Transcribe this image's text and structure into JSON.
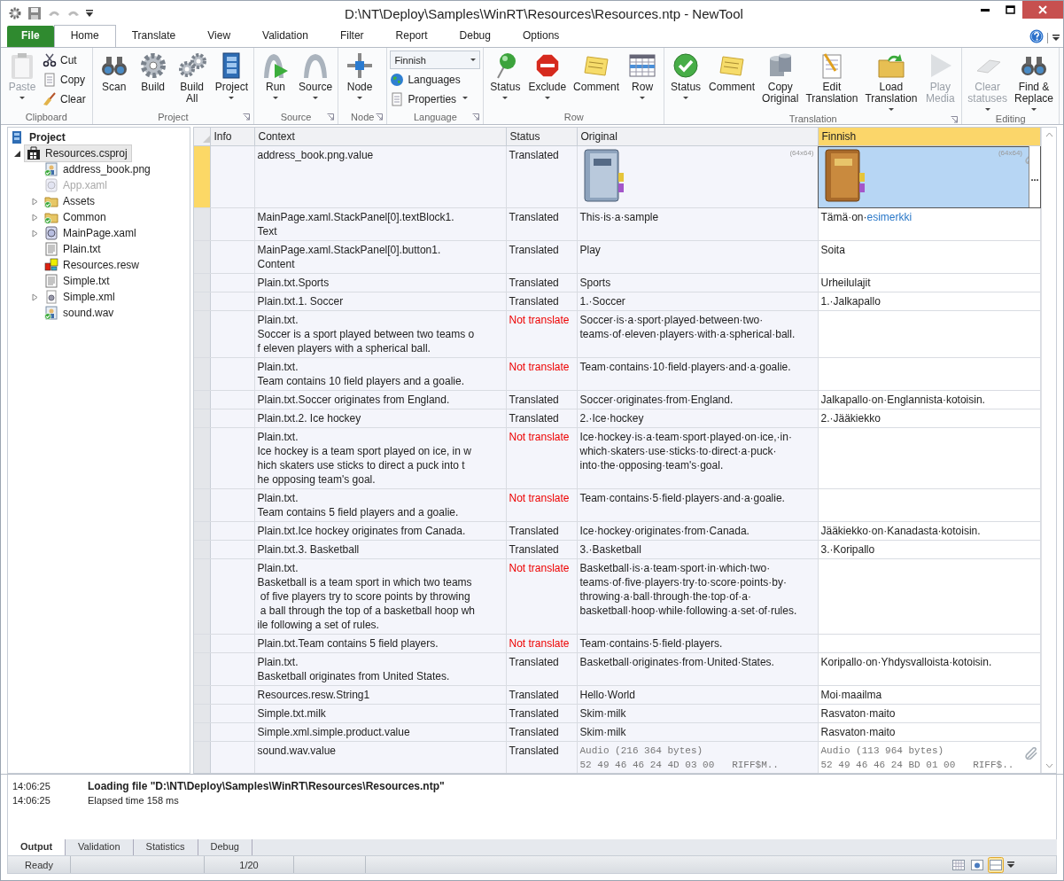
{
  "window": {
    "title": "D:\\NT\\Deploy\\Samples\\WinRT\\Resources\\Resources.ntp - NewTool"
  },
  "ribbon_tabs": [
    {
      "label": "File",
      "kind": "file",
      "selected": false
    },
    {
      "label": "Home",
      "kind": "tab",
      "selected": true
    },
    {
      "label": "Translate",
      "kind": "tab",
      "selected": false
    },
    {
      "label": "View",
      "kind": "tab",
      "selected": false
    },
    {
      "label": "Validation",
      "kind": "tab",
      "selected": false
    },
    {
      "label": "Filter",
      "kind": "tab",
      "selected": false
    },
    {
      "label": "Report",
      "kind": "tab",
      "selected": false
    },
    {
      "label": "Debug",
      "kind": "tab",
      "selected": false
    },
    {
      "label": "Options",
      "kind": "tab",
      "selected": false
    }
  ],
  "ribbon_groups": [
    {
      "title": "Clipboard",
      "launcher": false,
      "buttons": [
        {
          "kind": "large",
          "label": [
            "Paste"
          ],
          "has_menu": true,
          "disabled": true
        },
        {
          "kind": "small",
          "label": [
            "Cut"
          ],
          "has_menu": false,
          "disabled": false
        },
        {
          "kind": "small",
          "label": [
            "Copy"
          ],
          "has_menu": false,
          "disabled": false
        },
        {
          "kind": "small",
          "label": [
            "Clear"
          ],
          "has_menu": false,
          "disabled": false
        }
      ]
    },
    {
      "title": "Project",
      "launcher": true,
      "buttons": [
        {
          "kind": "large",
          "label": [
            "Scan"
          ],
          "has_menu": false,
          "disabled": false
        },
        {
          "kind": "large",
          "label": [
            "Build"
          ],
          "has_menu": false,
          "disabled": false
        },
        {
          "kind": "large",
          "label": [
            "Build",
            "All"
          ],
          "has_menu": false,
          "disabled": false
        },
        {
          "kind": "large",
          "label": [
            "Project"
          ],
          "has_menu": true,
          "disabled": false
        }
      ]
    },
    {
      "title": "Source",
      "launcher": true,
      "buttons": [
        {
          "kind": "large",
          "label": [
            "Run"
          ],
          "has_menu": true,
          "disabled": false
        },
        {
          "kind": "large",
          "label": [
            "Source"
          ],
          "has_menu": true,
          "disabled": false
        }
      ]
    },
    {
      "title": "Node",
      "launcher": true,
      "buttons": [
        {
          "kind": "large",
          "label": [
            "Node"
          ],
          "has_menu": true,
          "disabled": false
        }
      ]
    },
    {
      "title": "Language",
      "launcher": true,
      "buttons": [
        {
          "kind": "combo",
          "label": [
            "Finnish"
          ],
          "has_menu": true,
          "disabled": false
        },
        {
          "kind": "small",
          "label": [
            "Languages"
          ],
          "has_menu": false,
          "disabled": false
        },
        {
          "kind": "small",
          "label": [
            "Properties"
          ],
          "has_menu": true,
          "disabled": false
        }
      ]
    },
    {
      "title": "Row",
      "launcher": false,
      "buttons": [
        {
          "kind": "large",
          "label": [
            "Status"
          ],
          "has_menu": true,
          "disabled": false
        },
        {
          "kind": "large",
          "label": [
            "Exclude"
          ],
          "has_menu": true,
          "disabled": false
        },
        {
          "kind": "large",
          "label": [
            "Comment"
          ],
          "has_menu": false,
          "disabled": false
        },
        {
          "kind": "large",
          "label": [
            "Row"
          ],
          "has_menu": true,
          "disabled": false
        }
      ]
    },
    {
      "title": "Translation",
      "launcher": true,
      "buttons": [
        {
          "kind": "large",
          "label": [
            "Status"
          ],
          "has_menu": true,
          "disabled": false
        },
        {
          "kind": "large",
          "label": [
            "Comment"
          ],
          "has_menu": false,
          "disabled": false
        },
        {
          "kind": "large",
          "label": [
            "Copy",
            "Original"
          ],
          "has_menu": false,
          "disabled": false
        },
        {
          "kind": "large",
          "label": [
            "Edit",
            "Translation"
          ],
          "has_menu": false,
          "disabled": false
        },
        {
          "kind": "large",
          "label": [
            "Load",
            "Translation"
          ],
          "has_menu": true,
          "disabled": false
        },
        {
          "kind": "large",
          "label": [
            "Play",
            "Media"
          ],
          "has_menu": false,
          "disabled": true
        }
      ]
    },
    {
      "title": "Editing",
      "launcher": false,
      "buttons": [
        {
          "kind": "large",
          "label": [
            "Clear",
            "statuses"
          ],
          "has_menu": true,
          "disabled": true
        },
        {
          "kind": "large",
          "label": [
            "Find &",
            "Replace"
          ],
          "has_menu": true,
          "disabled": false
        }
      ]
    }
  ],
  "tree": {
    "label": "Project",
    "children": [
      {
        "label": "Resources.csproj",
        "kind": "project",
        "selected": true,
        "expanded": true,
        "translated": false,
        "disabled": false,
        "children": [
          {
            "label": "address_book.png",
            "kind": "image",
            "selected": false,
            "translated": true,
            "disabled": false
          },
          {
            "label": "App.xaml",
            "kind": "xaml",
            "selected": false,
            "translated": false,
            "disabled": true
          },
          {
            "label": "Assets",
            "kind": "folder",
            "selected": false,
            "expanded": false,
            "translated": true,
            "disabled": false
          },
          {
            "label": "Common",
            "kind": "folder",
            "selected": false,
            "expanded": false,
            "translated": true,
            "disabled": false
          },
          {
            "label": "MainPage.xaml",
            "kind": "xaml",
            "selected": false,
            "expanded": false,
            "translated": false,
            "disabled": false
          },
          {
            "label": "Plain.txt",
            "kind": "text",
            "selected": false,
            "translated": false,
            "disabled": false
          },
          {
            "label": "Resources.resw",
            "kind": "resw",
            "selected": false,
            "translated": false,
            "disabled": false
          },
          {
            "label": "Simple.txt",
            "kind": "text",
            "selected": false,
            "translated": false,
            "disabled": false
          },
          {
            "label": "Simple.xml",
            "kind": "xml",
            "selected": false,
            "expanded": false,
            "translated": false,
            "disabled": false
          },
          {
            "label": "sound.wav",
            "kind": "image",
            "selected": false,
            "translated": true,
            "disabled": false
          }
        ]
      }
    ]
  },
  "table": {
    "columns": [
      {
        "label": "Info",
        "selected": false
      },
      {
        "label": "Context",
        "selected": false
      },
      {
        "label": "Status",
        "selected": false
      },
      {
        "label": "Original",
        "selected": false
      },
      {
        "label": "Finnish",
        "selected": true
      }
    ],
    "edit_button": "...",
    "rows": [
      {
        "kind": "image",
        "selected": true,
        "linked": true,
        "context": [
          "address_book.png.value"
        ],
        "status": "Translated",
        "translated": true,
        "original": [
          "(64x64)"
        ],
        "translation": [
          "(64x64)"
        ]
      },
      {
        "kind": "text",
        "selected": false,
        "linked": false,
        "context": [
          "MainPage.xaml.StackPanel[0].textBlock1.",
          "Text"
        ],
        "status": "Translated",
        "translated": true,
        "original": [
          "This·is·a·sample"
        ],
        "translation": [
          "Tämä·on·"
        ],
        "translation_link": "esimerkki"
      },
      {
        "kind": "text",
        "selected": false,
        "linked": false,
        "context": [
          "MainPage.xaml.StackPanel[0].button1.",
          "Content"
        ],
        "status": "Translated",
        "translated": true,
        "original": [
          "Play"
        ],
        "translation": [
          "Soita"
        ]
      },
      {
        "kind": "text",
        "selected": false,
        "linked": false,
        "context": [
          "Plain.txt.Sports"
        ],
        "status": "Translated",
        "translated": true,
        "original": [
          "Sports"
        ],
        "translation": [
          "Urheilulajit"
        ]
      },
      {
        "kind": "text",
        "selected": false,
        "linked": false,
        "context": [
          "Plain.txt.1. Soccer"
        ],
        "status": "Translated",
        "translated": true,
        "original": [
          "1.·Soccer"
        ],
        "translation": [
          "1.·Jalkapallo"
        ]
      },
      {
        "kind": "text",
        "selected": false,
        "linked": false,
        "context": [
          "Plain.txt.",
          "Soccer is a sport played between two teams o",
          "f eleven players with a spherical ball."
        ],
        "status": "Not translate",
        "translated": false,
        "original": [
          "Soccer·is·a·sport·played·between·two·",
          "teams·of·eleven·players·with·a·spherical·ball."
        ],
        "translation": []
      },
      {
        "kind": "text",
        "selected": false,
        "linked": false,
        "context": [
          "Plain.txt.",
          "Team contains 10 field players and a goalie."
        ],
        "status": "Not translate",
        "translated": false,
        "original": [
          "Team·contains·10·field·players·and·a·goalie."
        ],
        "translation": []
      },
      {
        "kind": "text",
        "selected": false,
        "linked": false,
        "context": [
          "Plain.txt.Soccer originates from England."
        ],
        "status": "Translated",
        "translated": true,
        "original": [
          "Soccer·originates·from·England."
        ],
        "translation": [
          "Jalkapallo·on·Englannista·kotoisin."
        ]
      },
      {
        "kind": "text",
        "selected": false,
        "linked": false,
        "context": [
          "Plain.txt.2. Ice hockey"
        ],
        "status": "Translated",
        "translated": true,
        "original": [
          "2.·Ice·hockey"
        ],
        "translation": [
          "2.·Jääkiekko"
        ]
      },
      {
        "kind": "text",
        "selected": false,
        "linked": false,
        "context": [
          "Plain.txt.",
          "Ice hockey is a team sport played on ice, in w",
          "hich skaters use sticks to direct a puck into t",
          "he opposing team's goal."
        ],
        "status": "Not translate",
        "translated": false,
        "original": [
          "Ice·hockey·is·a·team·sport·played·on·ice,·in·",
          "which·skaters·use·sticks·to·direct·a·puck·",
          "into·the·opposing·team's·goal."
        ],
        "translation": []
      },
      {
        "kind": "text",
        "selected": false,
        "linked": false,
        "context": [
          "Plain.txt.",
          "Team contains 5 field players and a goalie."
        ],
        "status": "Not translate",
        "translated": false,
        "original": [
          "Team·contains·5·field·players·and·a·goalie."
        ],
        "translation": []
      },
      {
        "kind": "text",
        "selected": false,
        "linked": false,
        "context": [
          "Plain.txt.Ice hockey originates from Canada."
        ],
        "status": "Translated",
        "translated": true,
        "original": [
          "Ice·hockey·originates·from·Canada."
        ],
        "translation": [
          "Jääkiekko·on·Kanadasta·kotoisin."
        ]
      },
      {
        "kind": "text",
        "selected": false,
        "linked": false,
        "context": [
          "Plain.txt.3. Basketball"
        ],
        "status": "Translated",
        "translated": true,
        "original": [
          "3.·Basketball"
        ],
        "translation": [
          "3.·Koripallo"
        ]
      },
      {
        "kind": "text",
        "selected": false,
        "linked": false,
        "context": [
          "Plain.txt.",
          "Basketball is a team sport in which two teams",
          " of five players try to score points by throwing",
          " a ball through the top of a basketball hoop wh",
          "ile following a set of rules."
        ],
        "status": "Not translate",
        "translated": false,
        "original": [
          "Basketball·is·a·team·sport·in·which·two·",
          "teams·of·five·players·try·to·score·points·by·",
          "throwing·a·ball·through·the·top·of·a·",
          "basketball·hoop·while·following·a·set·of·rules."
        ],
        "translation": []
      },
      {
        "kind": "text",
        "selected": false,
        "linked": false,
        "context": [
          "Plain.txt.Team contains 5 field players."
        ],
        "status": "Not translate",
        "translated": false,
        "original": [
          "Team·contains·5·field·players."
        ],
        "translation": []
      },
      {
        "kind": "text",
        "selected": false,
        "linked": false,
        "context": [
          "Plain.txt.",
          "Basketball originates from United States."
        ],
        "status": "Translated",
        "translated": true,
        "original": [
          "Basketball·originates·from·United·States."
        ],
        "translation": [
          "Koripallo·on·Yhdysvalloista·kotoisin."
        ]
      },
      {
        "kind": "text",
        "selected": false,
        "linked": false,
        "context": [
          "Resources.resw.String1"
        ],
        "status": "Translated",
        "translated": true,
        "original": [
          "Hello·World"
        ],
        "translation": [
          "Moi·maailma"
        ]
      },
      {
        "kind": "text",
        "selected": false,
        "linked": false,
        "context": [
          "Simple.txt.milk"
        ],
        "status": "Translated",
        "translated": true,
        "original": [
          "Skim·milk"
        ],
        "translation": [
          "Rasvaton·maito"
        ]
      },
      {
        "kind": "text",
        "selected": false,
        "linked": false,
        "context": [
          "Simple.xml.simple.product.value"
        ],
        "status": "Translated",
        "translated": true,
        "original": [
          "Skim·milk"
        ],
        "translation": [
          "Rasvaton·maito"
        ]
      },
      {
        "kind": "audio",
        "selected": false,
        "linked": true,
        "context": [
          "sound.wav.value"
        ],
        "status": "Translated",
        "translated": true,
        "original": [
          "Audio (216 364 bytes)",
          "52 49 46 46 24 4D 03 00   RIFF$M.."
        ],
        "translation": [
          "Audio (113 964 bytes)",
          "52 49 46 46 24 BD 01 00   RIFF$.."
        ]
      }
    ]
  },
  "output": [
    {
      "time": "14:06:25",
      "message": "Loading file \"D:\\NT\\Deploy\\Samples\\WinRT\\Resources\\Resources.ntp\"",
      "bold": true
    },
    {
      "time": "14:06:25",
      "message": "Elapsed time 158 ms",
      "bold": false
    }
  ],
  "output_tabs": [
    {
      "label": "Output",
      "selected": true
    },
    {
      "label": "Validation",
      "selected": false
    },
    {
      "label": "Statistics",
      "selected": false
    },
    {
      "label": "Debug",
      "selected": false
    }
  ],
  "status_bar": {
    "state": "Ready",
    "position": "1/20",
    "views": [
      {
        "selected": false
      },
      {
        "selected": false
      },
      {
        "selected": true
      }
    ]
  }
}
